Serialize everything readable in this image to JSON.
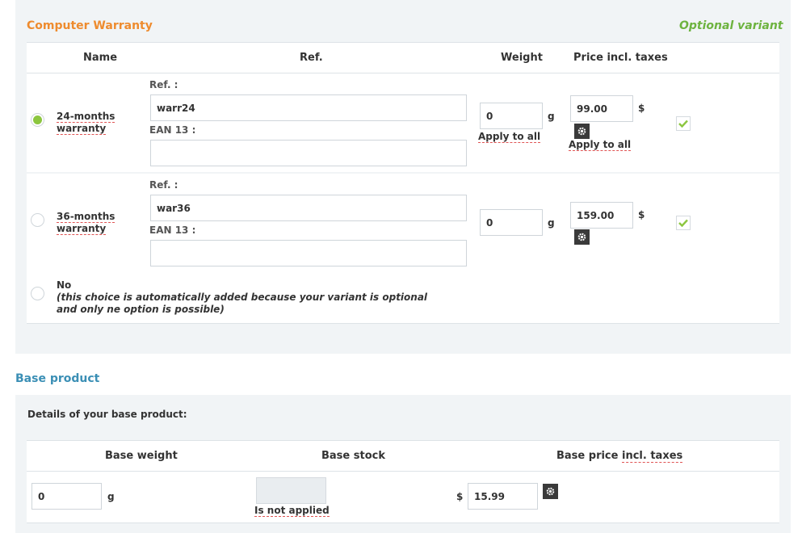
{
  "variant": {
    "title": "Computer Warranty",
    "tag": "Optional variant",
    "columns": {
      "name": "Name",
      "ref": "Ref.",
      "weight": "Weight",
      "price": "Price incl. taxes"
    },
    "options": [
      {
        "name_line1": "24-months",
        "name_line2": "warranty",
        "selected": true,
        "ref_label": "Ref. :",
        "ref_value": "warr24",
        "ean_label": "EAN 13 :",
        "ean_value": "",
        "weight": "0",
        "weight_unit": "g",
        "apply_weight": "Apply to all",
        "price": "99.00",
        "currency": "$",
        "apply_price": "Apply to all",
        "checked": true
      },
      {
        "name_line1": "36-months",
        "name_line2": "warranty",
        "selected": false,
        "ref_label": "Ref. :",
        "ref_value": "war36",
        "ean_label": "EAN 13 :",
        "ean_value": "",
        "weight": "0",
        "weight_unit": "g",
        "price": "159.00",
        "currency": "$",
        "checked": true
      }
    ],
    "no_option": {
      "label": "No",
      "note_line1": "(this choice is automatically added because your variant is optional",
      "note_line2": "and only ne option is possible)"
    }
  },
  "base": {
    "title": "Base product",
    "details": "Details of your base product:",
    "columns": {
      "weight": "Base weight",
      "stock": "Base stock",
      "price_prefix": "Base price",
      "price_suffix": "incl. taxes"
    },
    "weight": "0",
    "weight_unit": "g",
    "stock_note": "Is not applied",
    "currency": "$",
    "price": "15.99"
  },
  "colors": {
    "orange": "#ee8b2e",
    "green": "#6db33f",
    "blue": "#3b8fb5",
    "radio_on": "#8cc63f",
    "check": "#8cc63f"
  }
}
